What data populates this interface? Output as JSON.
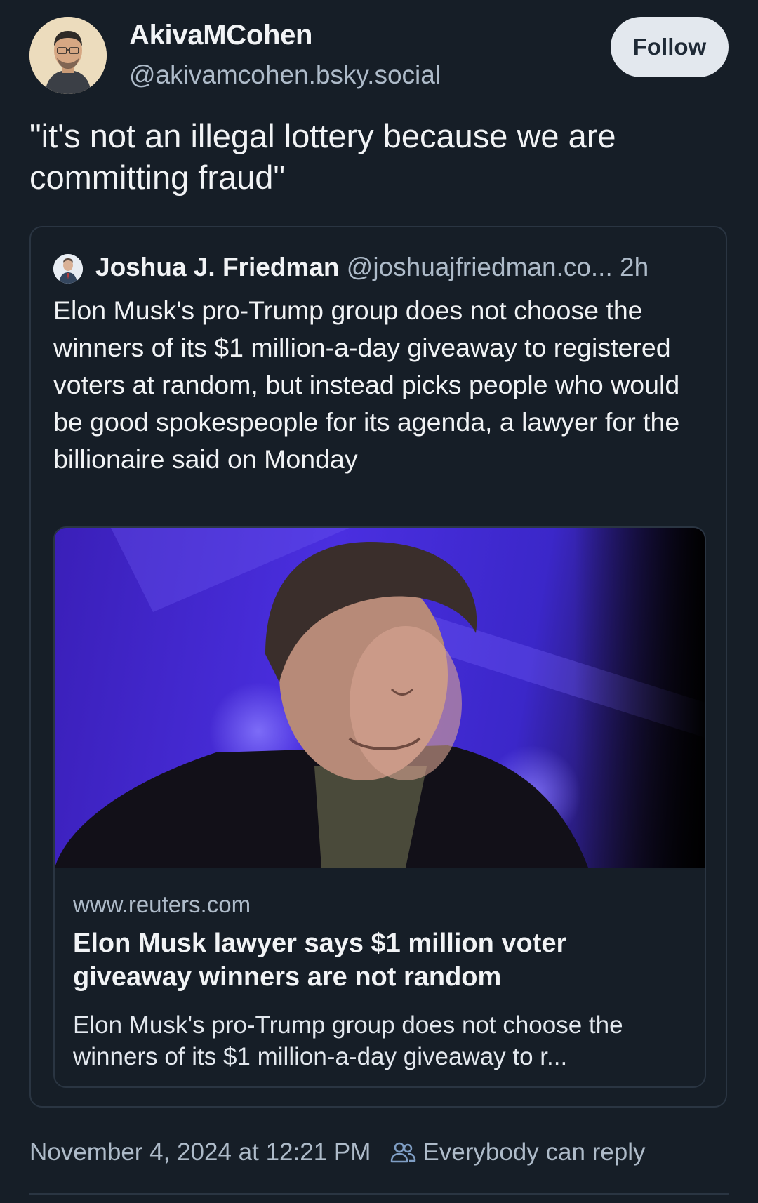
{
  "author": {
    "display_name": "AkivaMCohen",
    "handle": "@akivamcohen.bsky.social",
    "follow_label": "Follow"
  },
  "post": {
    "text": "\"it's not an illegal lottery because we are committing fraud\"",
    "timestamp": "November 4, 2024 at 12:21 PM",
    "reply_setting": "Everybody can reply"
  },
  "quote": {
    "author_name": "Joshua J. Friedman",
    "author_handle": "@joshuajfriedman.co...",
    "time_ago": "2h",
    "text": "Elon Musk's pro-Trump group does not choose the winners of its $1 million-a-day giveaway to registered voters at random, but instead picks people who would be good spokespeople for its agenda, a lawyer for the billionaire said on Monday",
    "link": {
      "domain": "www.reuters.com",
      "title": "Elon Musk lawyer says $1 million voter giveaway winners are not random",
      "description": "Elon Musk's pro-Trump group does not choose the winners of its $1 million-a-day giveaway to r..."
    }
  },
  "icons": {
    "reply_setting_icon": "people-icon"
  },
  "colors": {
    "background": "#161e27",
    "muted_text": "#aebbc9",
    "border": "#2a3542",
    "follow_button_bg": "#e3e8ee"
  }
}
